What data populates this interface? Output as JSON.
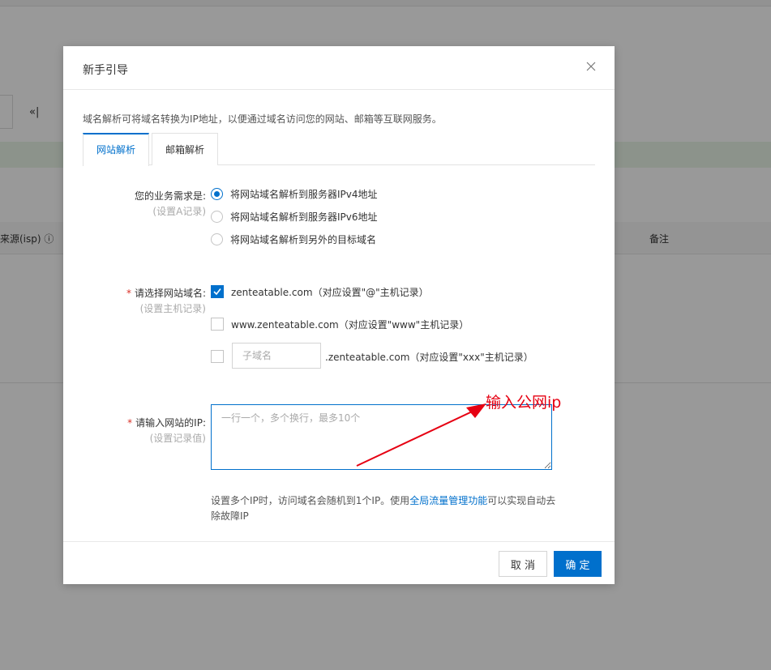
{
  "background": {
    "collapse_icon": "«|",
    "source_header": "来源(isp)",
    "note_header": "备注"
  },
  "dialog": {
    "title": "新手引导",
    "intro": "域名解析可将域名转换为IP地址，以便通过域名访问您的网站、邮箱等互联网服务。",
    "tabs": [
      {
        "label": "网站解析",
        "active": true
      },
      {
        "label": "邮箱解析",
        "active": false
      }
    ],
    "need": {
      "label": "您的业务需求是:",
      "sub": "(设置A记录)",
      "options": [
        {
          "label": "将网站域名解析到服务器IPv4地址",
          "checked": true
        },
        {
          "label": "将网站域名解析到服务器IPv6地址",
          "checked": false
        },
        {
          "label": "将网站域名解析到另外的目标域名",
          "checked": false
        }
      ]
    },
    "domain": {
      "label": "请选择网站域名:",
      "sub": "(设置主机记录)",
      "options": [
        {
          "label": "zenteatable.com（对应设置\"@\"主机记录）",
          "checked": true
        },
        {
          "label": "www.zenteatable.com（对应设置\"www\"主机记录）",
          "checked": false
        }
      ],
      "custom": {
        "placeholder": "子域名",
        "suffix": ".zenteatable.com（对应设置\"xxx\"主机记录）",
        "checked": false
      }
    },
    "ip": {
      "label": "请输入网站的IP:",
      "sub": "(设置记录值)",
      "placeholder": "一行一个，多个换行，最多10个"
    },
    "hint": {
      "before": "设置多个IP时，访问域名会随机到1个IP。使用",
      "link": "全局流量管理功能",
      "after": "可以实现自动去除故障IP"
    },
    "buttons": {
      "cancel": "取 消",
      "ok": "确 定"
    }
  },
  "annotation": {
    "text": "输入公网ip",
    "color": "#e60012"
  },
  "colors": {
    "accent": "#0070cc",
    "required": "#d93026"
  }
}
